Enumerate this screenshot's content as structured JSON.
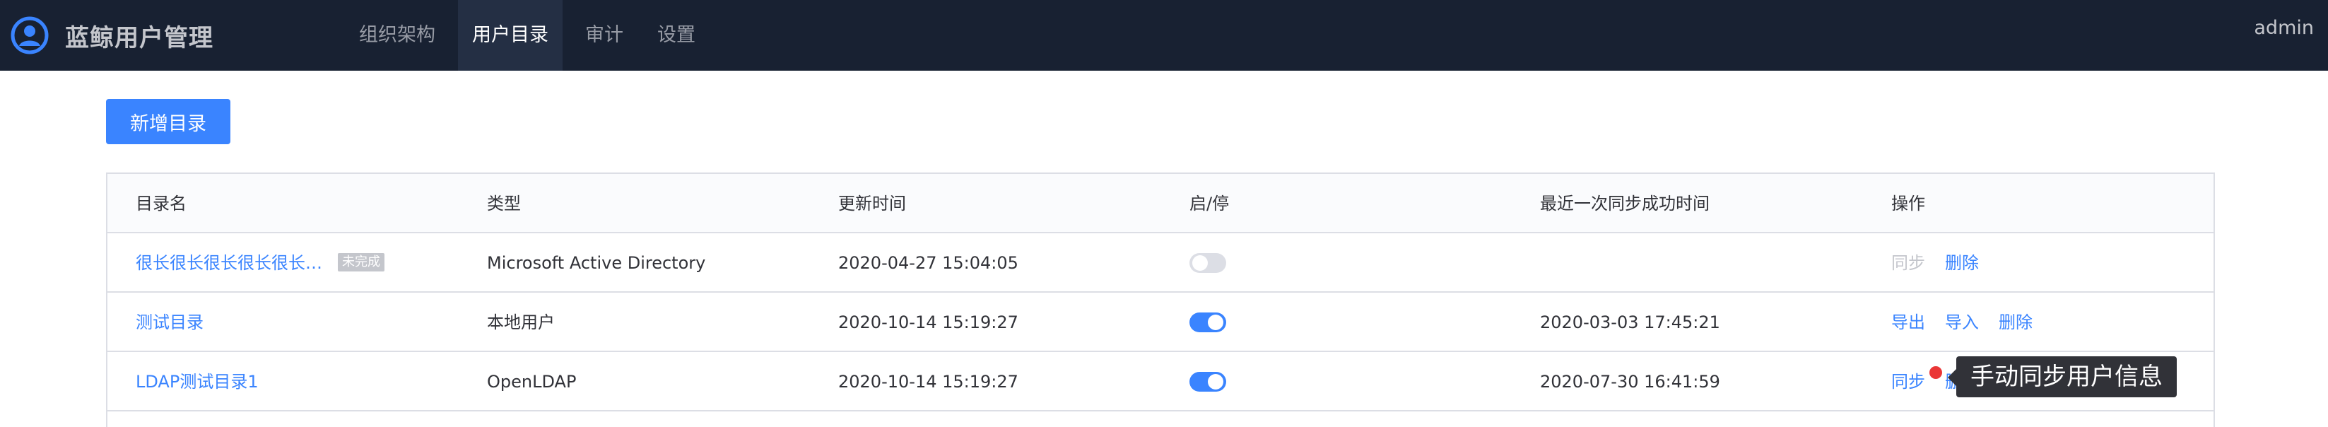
{
  "app": {
    "title": "蓝鲸用户管理"
  },
  "nav": {
    "tabs": [
      {
        "label": "组织架构",
        "active": false
      },
      {
        "label": "用户目录",
        "active": true
      },
      {
        "label": "审计",
        "active": false
      },
      {
        "label": "设置",
        "active": false
      }
    ],
    "user": "admin"
  },
  "toolbar": {
    "add_label": "新增目录"
  },
  "table": {
    "headers": {
      "name": "目录名",
      "type": "类型",
      "updated": "更新时间",
      "enabled": "启/停",
      "last_sync": "最近一次同步成功时间",
      "ops": "操作"
    },
    "rows": [
      {
        "name": "很长很长很长很长很长…",
        "badge": "未完成",
        "type": "Microsoft Active Directory",
        "updated": "2020-04-27 15:04:05",
        "enabled": false,
        "last_sync": "",
        "ops": [
          "同步",
          "删除"
        ]
      },
      {
        "name": "测试目录",
        "type": "本地用户",
        "updated": "2020-10-14 15:19:27",
        "enabled": true,
        "last_sync": "2020-03-03 17:45:21",
        "ops": [
          "导出",
          "导入",
          "删除"
        ]
      },
      {
        "name": "LDAP测试目录1",
        "type": "OpenLDAP",
        "updated": "2020-10-14 15:19:27",
        "enabled": true,
        "last_sync": "2020-07-30 16:41:59",
        "ops": [
          "同步",
          "删除"
        ]
      }
    ]
  },
  "tooltip": {
    "text": "手动同步用户信息"
  },
  "colors": {
    "nav_bg": "#182132",
    "accent": "#3a84ff",
    "disabled": "#c4c6cc",
    "marker": "#ea3636"
  }
}
